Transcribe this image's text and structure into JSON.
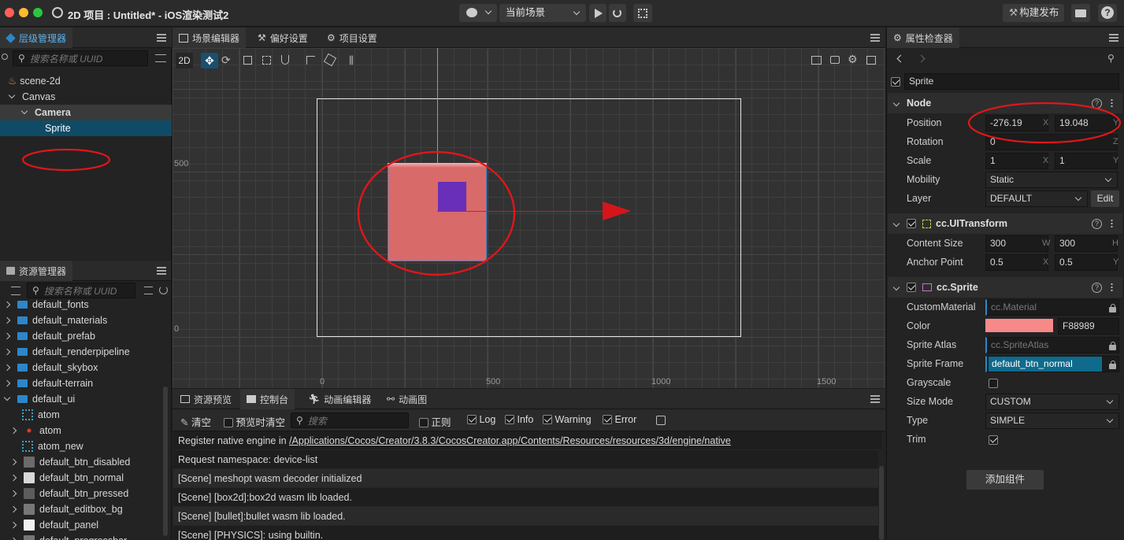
{
  "titlebar": {
    "title": "2D 项目 : Untitled* - iOS渲染测试2",
    "scene_select": "当前场景",
    "build_button": "构建发布"
  },
  "hierarchy": {
    "tab_label": "层级管理器",
    "search_placeholder": "搜索名称或 UUID",
    "nodes": [
      "scene-2d",
      "Canvas",
      "Camera",
      "Sprite"
    ]
  },
  "assets": {
    "tab_label": "资源管理器",
    "search_placeholder": "搜索名称或 UUID",
    "items": [
      "default_fonts",
      "default_materials",
      "default_prefab",
      "default_renderpipeline",
      "default_skybox",
      "default-terrain",
      "default_ui",
      "atom",
      "atom",
      "atom_new",
      "default_btn_disabled",
      "default_btn_normal",
      "default_btn_pressed",
      "default_editbox_bg",
      "default_panel",
      "default_progressbar"
    ]
  },
  "scene_editor": {
    "tabs": [
      "场景编辑器",
      "偏好设置",
      "项目设置"
    ],
    "mode_2d": "2D",
    "ruler_y": [
      "500",
      "0"
    ],
    "ruler_x": [
      "0",
      "500",
      "1000",
      "1500"
    ]
  },
  "console": {
    "tabs": [
      "资源预览",
      "控制台",
      "动画编辑器",
      "动画图"
    ],
    "clear_label": "清空",
    "preview_clear_label": "预览时清空",
    "search_placeholder": "搜索",
    "regex_label": "正则",
    "log_label": "Log",
    "info_label": "Info",
    "warning_label": "Warning",
    "error_label": "Error",
    "lines": [
      {
        "prefix": "Register native engine in ",
        "link": "/Applications/Cocos/Creator/3.8.3/CocosCreator.app/Contents/Resources/resources/3d/engine/native"
      },
      {
        "prefix": "Request namespace: device-list",
        "link": ""
      },
      {
        "prefix": "[Scene] meshopt wasm decoder initialized",
        "link": ""
      },
      {
        "prefix": "[Scene] [box2d]:box2d wasm lib loaded.",
        "link": ""
      },
      {
        "prefix": "[Scene] [bullet]:bullet wasm lib loaded.",
        "link": ""
      },
      {
        "prefix": "[Scene] [PHYSICS]: using builtin.",
        "link": ""
      }
    ]
  },
  "inspector": {
    "tab_label": "属性检查器",
    "node_name": "Sprite",
    "node_section": "Node",
    "position": {
      "label": "Position",
      "x": "-276.19",
      "y": "19.048",
      "x_axis": "X",
      "y_axis": "Y"
    },
    "rotation": {
      "label": "Rotation",
      "z": "0",
      "z_axis": "Z"
    },
    "scale": {
      "label": "Scale",
      "x": "1",
      "y": "1",
      "x_axis": "X",
      "y_axis": "Y"
    },
    "mobility": {
      "label": "Mobility",
      "value": "Static"
    },
    "layer": {
      "label": "Layer",
      "value": "DEFAULT",
      "edit": "Edit"
    },
    "uitransform_section": "cc.UITransform",
    "content_size": {
      "label": "Content Size",
      "w": "300",
      "h": "300",
      "w_axis": "W",
      "h_axis": "H"
    },
    "anchor_point": {
      "label": "Anchor Point",
      "x": "0.5",
      "y": "0.5",
      "x_axis": "X",
      "y_axis": "Y"
    },
    "sprite_section": "cc.Sprite",
    "custom_material": {
      "label": "CustomMaterial",
      "value": "cc.Material"
    },
    "color": {
      "label": "Color",
      "hex": "F88989",
      "swatch": "#F88989"
    },
    "sprite_atlas": {
      "label": "Sprite Atlas",
      "value": "cc.SpriteAtlas"
    },
    "sprite_frame": {
      "label": "Sprite Frame",
      "value": "default_btn_normal"
    },
    "grayscale": {
      "label": "Grayscale"
    },
    "size_mode": {
      "label": "Size Mode",
      "value": "CUSTOM"
    },
    "type": {
      "label": "Type",
      "value": "SIMPLE"
    },
    "trim": {
      "label": "Trim"
    },
    "add_component": "添加组件"
  },
  "colors": {
    "accent": "#2d86c9",
    "annotation_red": "#e0161b",
    "sprite_fill": "#d96a6a",
    "camera_icon": "#6a2fb8",
    "selected_row": "#0f4b66"
  }
}
